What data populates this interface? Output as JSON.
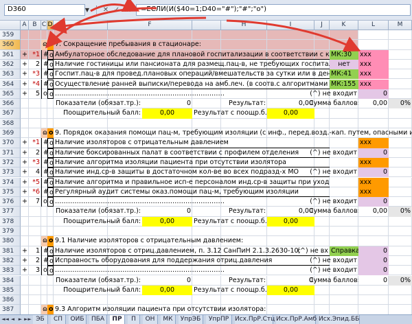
{
  "formula_bar": {
    "name_box": "D360",
    "name_arrow": "▼",
    "fx_buttons": [
      "✕",
      "✓",
      "fx"
    ],
    "formula": "=ЕСЛИ(И($40=1;D40=\"#\");\"#\";\"o\")"
  },
  "columns": [
    {
      "id": "A",
      "label": "A"
    },
    {
      "id": "B",
      "label": "B"
    },
    {
      "id": "C",
      "label": "C"
    },
    {
      "id": "D",
      "label": "D"
    },
    {
      "id": "E",
      "label": ""
    },
    {
      "id": "F",
      "label": "F"
    },
    {
      "id": "G",
      "label": ""
    },
    {
      "id": "H",
      "label": "H"
    },
    {
      "id": "I",
      "label": "I"
    },
    {
      "id": "J",
      "label": "J"
    },
    {
      "id": "K",
      "label": "K"
    },
    {
      "id": "L",
      "label": "L"
    },
    {
      "id": "M",
      "label": "M"
    }
  ],
  "rows": [
    "359",
    "360",
    "361",
    "362",
    "363",
    "364",
    "365",
    "366",
    "367",
    "368",
    "369",
    "370",
    "371",
    "372",
    "373",
    "374",
    "375",
    "376",
    "377",
    "378",
    "379",
    "380",
    "381",
    "382",
    "383",
    "384",
    "385",
    "386",
    "387"
  ],
  "sheet": {
    "r360": {
      "dtag": "o",
      "etag": "o",
      "title": "7. Сокращение пребывания в стационаре:"
    },
    "r361": {
      "a": "+",
      "b": "*1",
      "c": "#",
      "d": "o",
      "text": "Амбулаторное обследование для плановой госпитализации в соответствии с кли",
      "k": "МК:30",
      "l": "xxx"
    },
    "r362": {
      "a": "+",
      "b": "2",
      "c": "#",
      "d": "o",
      "text": "Наличие гостиницы или пансионата для размещ.пац-в, не требующих госпитали",
      "k": "нет",
      "l": "xxx"
    },
    "r363": {
      "a": "+",
      "b": "*3",
      "c": "#",
      "d": "o",
      "text": "Госпит.пац-в для провед.плановых операций/вмешательств за сутки или в день",
      "k": "МК:41",
      "l": "xxx"
    },
    "r364": {
      "a": "+",
      "b": "*4",
      "c": "#",
      "d": "o",
      "text": "Осуществление ранней выписки/перевода на амб.леч. (в соотв.с алгоритмами",
      "k": "МК:155",
      "l": "xxx"
    },
    "r365": {
      "a": "+",
      "b": "5",
      "c": "o",
      "d": "o",
      "dots": "……………………………………………………………………",
      "j": "(^) не входит",
      "l": "0"
    },
    "r366": {
      "f_lbl": "Показатели (обязат.тр.):",
      "f": "0",
      "h_lbl": "Результат:",
      "i": "0,00",
      "j_lbl": "Сумма баллов:",
      "l": "0,00",
      "m": "0%"
    },
    "r367": {
      "f_lbl": "Поощрительный балл:",
      "f": "0,00",
      "h_lbl": "Результат с поощр.б.:",
      "i": "0,00"
    },
    "r369": {
      "dtag": "o",
      "etag": "o",
      "title": "9.  Порядок оказания помощи пац-м, требующим изоляции (с инф., перед.возд.-кап. путем, опасными и"
    },
    "r370": {
      "a": "+",
      "b": "*1",
      "c": "#",
      "d": "o",
      "text": "Наличие изоляторов с отрицательным давлением",
      "l": "xxx"
    },
    "r371": {
      "a": "+",
      "b": "2",
      "c": "#",
      "d": "o",
      "text": "Наличие боксированных палат в соответствии с профилем отделения",
      "j": "(^) не входит",
      "l": "0"
    },
    "r372": {
      "a": "+",
      "b": "*3",
      "c": "#",
      "d": "o",
      "text": "Наличие алгоритма изоляции пациента при отсутствии изолятора",
      "l": "xxx"
    },
    "r373": {
      "a": "+",
      "b": "4",
      "c": "#",
      "d": "o",
      "text": "Наличие инд.ср-в защиты в достаточном кол-ве во всех подразд-х МО",
      "j": "(^) не входит",
      "l": "0"
    },
    "r374": {
      "a": "+",
      "b": "*5",
      "c": "#",
      "d": "o",
      "text": "Наличие алгоритма и правильное исп-е персоналом инд.ср-в защиты при уходе за пац",
      "l": "xxx"
    },
    "r375": {
      "a": "+",
      "b": "*6",
      "c": "#",
      "d": "o",
      "text": "Регулярный аудит системы оказ.помощи пац-м, требующим изоляции",
      "l": "xxx"
    },
    "r376": {
      "a": "+",
      "b": "7",
      "c": "o",
      "d": "o",
      "dots": "……………………………………………………………………",
      "j": "(^) не входит",
      "l": "0"
    },
    "r377": {
      "f_lbl": "Показатели (обязат.тр.):",
      "f": "0",
      "h_lbl": "Результат:",
      "i": "0,00",
      "j_lbl": "Сумма баллов:",
      "l": "0,00",
      "m": "0%"
    },
    "r378": {
      "f_lbl": "Поощрительный балл:",
      "f": "0,00",
      "h_lbl": "Результат с поощр.б.:",
      "i": "0,00"
    },
    "r380": {
      "dtag": "o",
      "etag": "o",
      "title": "9.1  Наличие изоляторов с отрицательным давлением:"
    },
    "r381": {
      "a": "+",
      "b": "1",
      "c": "#",
      "d": "o",
      "text": "Наличие изоляторов с отриц.давлением, п. 3.12 СанПиН 2.1.3.2630-10:",
      "j": "(^) не вх",
      "k": "Справка",
      "l": "0"
    },
    "r382": {
      "a": "+",
      "b": "2",
      "c": "#",
      "d": "o",
      "text": "Исправность оборудования для поддержания отриц.давления",
      "j": "(^) не входит",
      "l": "0"
    },
    "r383": {
      "a": "+",
      "b": "3",
      "c": "o",
      "d": "o",
      "dots": "……………………………………………………………………",
      "j": "(^) не входит",
      "l": "0"
    },
    "r384": {
      "f_lbl": "Показатели (обязат.тр.):",
      "f": "0",
      "h_lbl": "Результат:",
      "i": "0",
      "j_lbl": "Сумма баллов:",
      "l": "0",
      "m": "0%"
    },
    "r385": {
      "f_lbl": "Поощрительный балл:",
      "f": "0,00",
      "h_lbl": "Результат с поощр.б.:",
      "i": "0,00"
    },
    "r387": {
      "dtag": "o",
      "etag": "o",
      "title": "9.3  Алгоритм изоляции пациента при отсутствии изолятора:"
    }
  },
  "tabs": {
    "nav": [
      "◄◄",
      "◄",
      "►",
      "►►"
    ],
    "items": [
      "ЭБ",
      "СП",
      "ОИБ",
      "ПБА",
      "ПР",
      "П",
      "ОН",
      "МК",
      "УпрЭБ",
      "УпрПР",
      "Исх.ПрР.Стц",
      "Исх.ПрР.Амб",
      "Исх.Эпид.ББ"
    ],
    "active": "ПР"
  },
  "colors": {
    "pink": "#ff8db5",
    "orange": "#ff9a00",
    "green": "#92d050",
    "arrow": "#e03a2f"
  }
}
